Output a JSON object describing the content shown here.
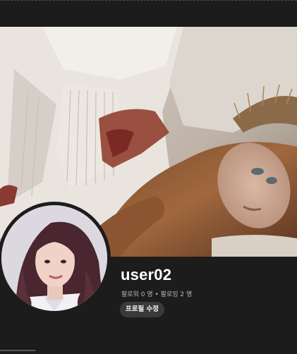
{
  "profile": {
    "username": "user02",
    "followers_label": "팔로워",
    "followers_count": "0",
    "following_label": "팔로잉",
    "following_count": "2",
    "count_unit": "명",
    "separator": "•",
    "edit_button_label": "프로필 수정"
  },
  "colors": {
    "background": "#1c1c1c",
    "button_bg": "#3a3a3a",
    "secondary_text": "#b8b8b8"
  }
}
